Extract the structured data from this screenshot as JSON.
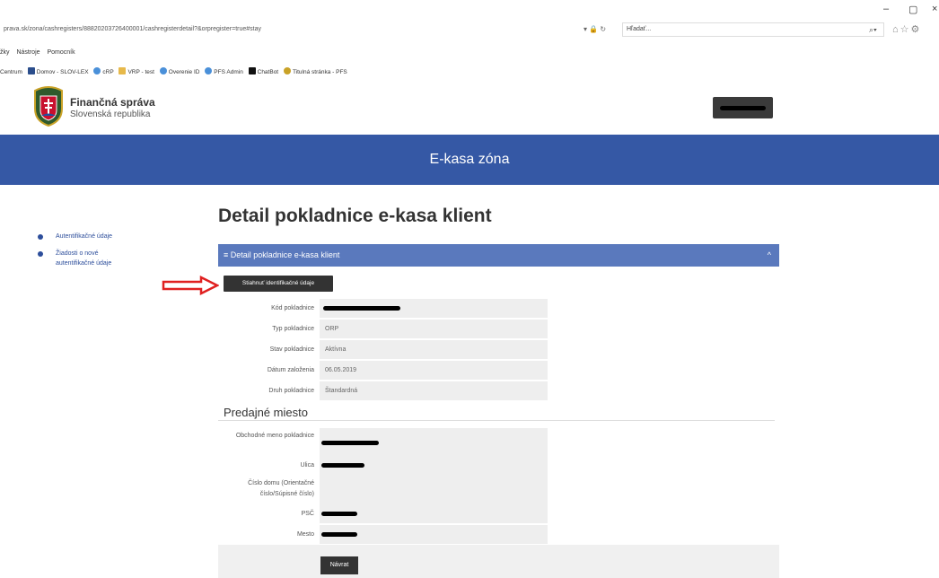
{
  "browser": {
    "url": "prava.sk/zona/cashregisters/88820203726400001/cashregisterdetail?&orpregister=true#stay",
    "search_placeholder": "Hľadať...",
    "window_controls": [
      "–",
      "▢",
      "×"
    ],
    "menu": [
      "žky",
      "Nástroje",
      "Pomocník"
    ],
    "favorites": [
      "Centrum",
      "Domov - SLOV-LEX",
      "cRP",
      "VRP - test",
      "Overenie ID",
      "PFS Admin",
      "ChatBot",
      "Titulná stránka - PFS"
    ]
  },
  "header": {
    "title": "Finančná správa",
    "subtitle": "Slovenská republika"
  },
  "banner": {
    "title": "E-kasa zóna"
  },
  "sidebar": {
    "items": [
      {
        "label": "Autentifikačné údaje"
      },
      {
        "label": "Žiadosti o nové autentifikačné údaje"
      }
    ]
  },
  "main": {
    "title": "Detail pokladnice e-kasa klient",
    "panel_title": "Detail pokladnice e-kasa klient",
    "download_button": "Stiahnuť identifikačné údaje",
    "fields": [
      {
        "label": "Kód pokladnice",
        "value": ""
      },
      {
        "label": "Typ pokladnice",
        "value": "ORP"
      },
      {
        "label": "Stav pokladnice",
        "value": "Aktívna"
      },
      {
        "label": "Dátum založenia",
        "value": "06.05.2019"
      },
      {
        "label": "Druh pokladnice",
        "value": "Štandardná"
      }
    ],
    "section_title": "Predajné miesto",
    "place_fields": [
      {
        "label": "Obchodné meno pokladnice",
        "value": ""
      },
      {
        "label": "Ulica",
        "value": ""
      },
      {
        "label": "Číslo domu (Orientačné číslo/Súpisné číslo)",
        "value": ""
      },
      {
        "label": "PSČ",
        "value": ""
      },
      {
        "label": "Mesto",
        "value": ""
      }
    ],
    "back_button": "Návrat"
  }
}
